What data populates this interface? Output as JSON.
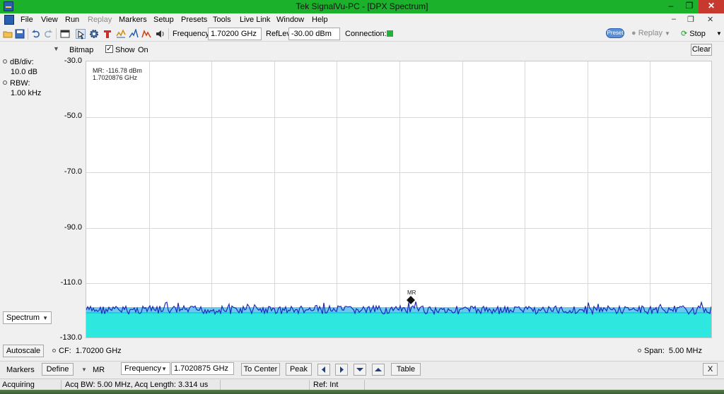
{
  "window": {
    "title": "Tek SignalVu-PC - [DPX Spectrum]",
    "controls": {
      "minimize": "–",
      "restore": "❐",
      "close": "✕"
    }
  },
  "menu": {
    "items": [
      "File",
      "View",
      "Run",
      "Replay",
      "Markers",
      "Setup",
      "Presets",
      "Tools",
      "Live Link",
      "Window",
      "Help"
    ],
    "disabled": [
      "Replay"
    ],
    "mdi_controls": {
      "minimize": "–",
      "restore": "❐",
      "close": "✕"
    }
  },
  "toolbar": {
    "frequency_label": "Frequency:",
    "frequency_value": "1.70200 GHz",
    "reflev_label": "RefLev:",
    "reflev_value": "-30.00 dBm",
    "connection_label": "Connection:",
    "connection_color": "#1fb33c",
    "preset_label": "Preset",
    "replay_label": "Replay",
    "stop_label": "Stop",
    "icons": [
      "open-folder-icon",
      "save-icon",
      "undo-icon",
      "redo-icon",
      "window-icon",
      "select-pointer-icon",
      "settings-gear-icon",
      "text-marker-icon",
      "trace-icon",
      "peak-icon",
      "zoom-icon",
      "audio-icon"
    ]
  },
  "display": {
    "header": {
      "bitmap_label": "Bitmap",
      "show_label": "Show",
      "show_checked": "✓",
      "on_label": "On",
      "clear_label": "Clear"
    },
    "params": {
      "db_div_label": "dB/div:",
      "db_div_value": "10.0 dB",
      "rbw_label": "RBW:",
      "rbw_value": "1.00 kHz"
    },
    "y_ticks": [
      "-30.0",
      "-50.0",
      "-70.0",
      "-90.0",
      "-110.0",
      "-130.0"
    ],
    "readout_line1": "MR: -116.78 dBm",
    "readout_line2": "1.7020876 GHz",
    "marker_label": "MR",
    "view_select": "Spectrum",
    "autoscale_label": "Autoscale",
    "cf_label": "CF:",
    "cf_value": "1.70200 GHz",
    "span_label": "Span:",
    "span_value": "5.00 MHz",
    "trace_color": "#1a2bb8",
    "bitmap_color": "#2ee8e0"
  },
  "markers_bar": {
    "markers_label": "Markers",
    "define_label": "Define",
    "marker_name": "MR",
    "param_select": "Frequency",
    "param_value": "1.7020875 GHz",
    "to_center_label": "To Center",
    "peak_label": "Peak",
    "table_label": "Table",
    "close_label": "X"
  },
  "status": {
    "state": "Acquiring",
    "acq": "Acq BW: 5.00 MHz, Acq Length: 3.314 us",
    "ref": "Ref: Int"
  }
}
